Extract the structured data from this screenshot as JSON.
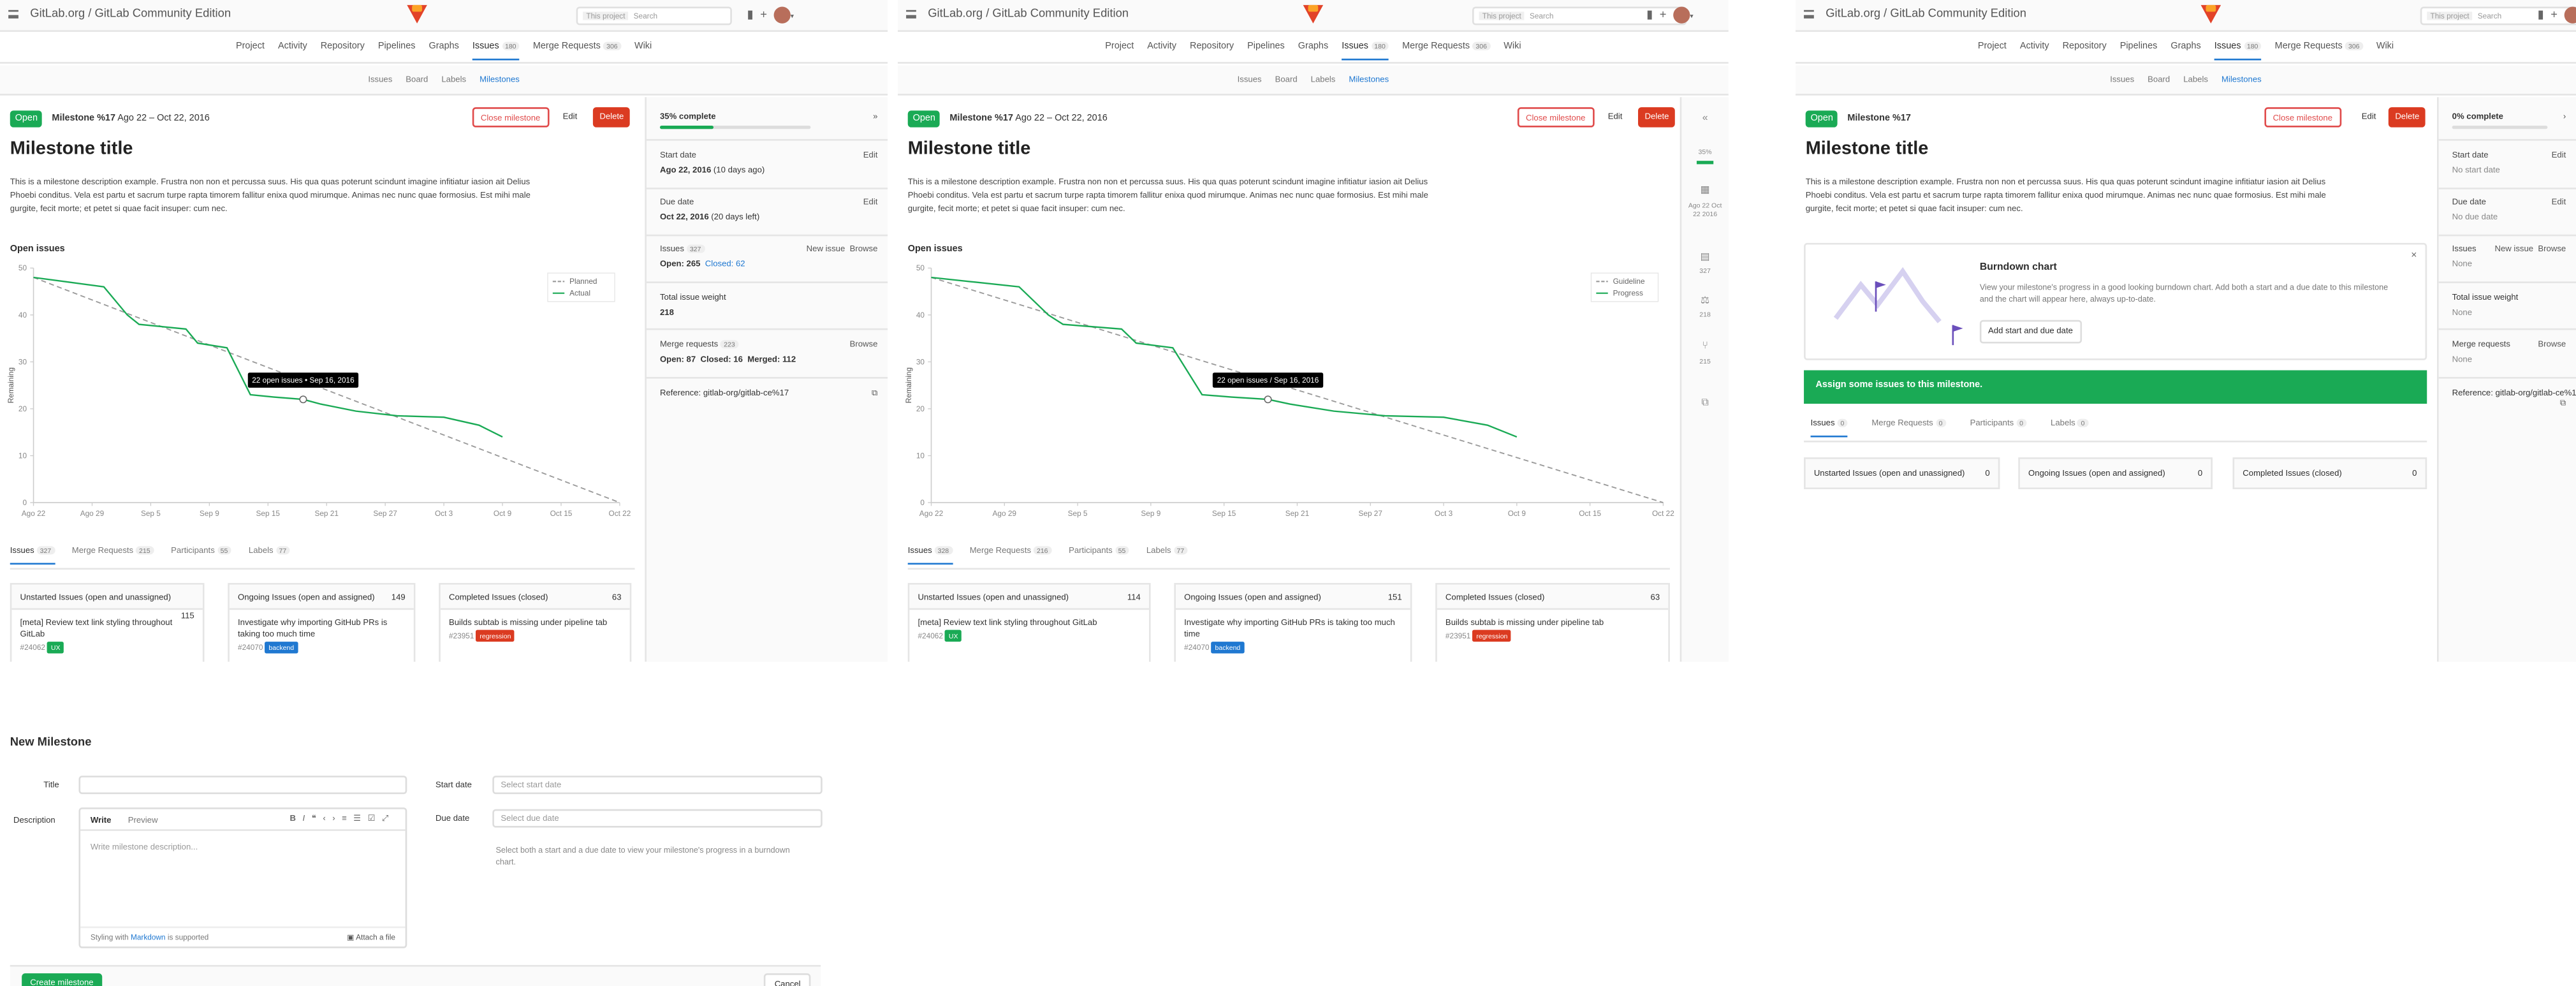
{
  "header": {
    "breadcrumb": "GitLab.org / GitLab Community Edition",
    "search_scope": "This project",
    "search_placeholder": "Search"
  },
  "nav": {
    "project": "Project",
    "activity": "Activity",
    "repository": "Repository",
    "pipelines": "Pipelines",
    "graphs": "Graphs",
    "issues": "Issues",
    "issues_count": "180",
    "merge_requests": "Merge Requests",
    "mr_count": "306",
    "wiki": "Wiki"
  },
  "subnav": {
    "issues": "Issues",
    "board": "Board",
    "labels": "Labels",
    "milestones": "Milestones"
  },
  "milestone": {
    "status": "Open",
    "name": "Milestone %17",
    "dates": "Ago 22 – Oct 22, 2016",
    "close_label": "Close milestone",
    "edit_label": "Edit",
    "delete_label": "Delete",
    "title": "Milestone title",
    "description": "This is a milestone description example. Frustra non non et percussa suus. His qua quas poterunt scindunt imagine infitiatur iasion ait Delius Phoebi conditus. Vela est partu et sacrum turpe rapta timorem fallitur enixa quod mirumque. Animas nec nunc quae formosius. Est mihi male gurgite, fecit morte; et petet si quae facit insuper: cum nec."
  },
  "chart_data": [
    {
      "type": "line",
      "title": "Open issues",
      "ylabel": "Remaining",
      "xlabel": "",
      "x_ticks": [
        "Ago 22",
        "Ago 29",
        "Sep 5",
        "Sep 9",
        "Sep 15",
        "Sep 21",
        "Sep 27",
        "Oct 3",
        "Oct 9",
        "Oct 15",
        "Oct 22"
      ],
      "y_ticks": [
        0,
        10,
        20,
        30,
        40,
        50
      ],
      "ylim": [
        0,
        50
      ],
      "legend_position": "top-right",
      "series": [
        {
          "name": "Planned",
          "style": "dashed",
          "color": "#999999",
          "points": [
            [
              0,
              48
            ],
            [
              10,
              0
            ]
          ]
        },
        {
          "name": "Actual",
          "style": "solid",
          "color": "#1aaa55",
          "points": [
            [
              0,
              48
            ],
            [
              0.6,
              47
            ],
            [
              1.2,
              46
            ],
            [
              1.6,
              40
            ],
            [
              1.8,
              38
            ],
            [
              2.6,
              37
            ],
            [
              2.8,
              34
            ],
            [
              3.3,
              33
            ],
            [
              3.5,
              28
            ],
            [
              3.7,
              23
            ],
            [
              4.1,
              22.5
            ],
            [
              4.6,
              22
            ],
            [
              4.9,
              21
            ],
            [
              5.5,
              19.5
            ],
            [
              6.2,
              18.5
            ],
            [
              7.0,
              18.2
            ],
            [
              7.6,
              16.5
            ],
            [
              8.0,
              14
            ]
          ]
        }
      ],
      "tooltip": "22 open issues • Sep 16, 2016"
    },
    {
      "type": "line",
      "title": "Open issues",
      "ylabel": "Remaining",
      "xlabel": "",
      "x_ticks": [
        "Ago 22",
        "Ago 29",
        "Sep 5",
        "Sep 9",
        "Sep 15",
        "Sep 21",
        "Sep 27",
        "Oct 3",
        "Oct 9",
        "Oct 15",
        "Oct 22"
      ],
      "y_ticks": [
        0,
        10,
        20,
        30,
        40,
        50
      ],
      "ylim": [
        0,
        50
      ],
      "legend_position": "top-right",
      "series": [
        {
          "name": "Guideline",
          "style": "dashed",
          "color": "#999999",
          "points": [
            [
              0,
              48
            ],
            [
              10,
              0
            ]
          ]
        },
        {
          "name": "Progress",
          "style": "solid",
          "color": "#1aaa55",
          "points": [
            [
              0,
              48
            ],
            [
              0.6,
              47
            ],
            [
              1.2,
              46
            ],
            [
              1.6,
              40
            ],
            [
              1.8,
              38
            ],
            [
              2.6,
              37
            ],
            [
              2.8,
              34
            ],
            [
              3.3,
              33
            ],
            [
              3.5,
              28
            ],
            [
              3.7,
              23
            ],
            [
              4.1,
              22.5
            ],
            [
              4.6,
              22
            ],
            [
              4.9,
              21
            ],
            [
              5.5,
              19.5
            ],
            [
              6.2,
              18.5
            ],
            [
              7.0,
              18.2
            ],
            [
              7.6,
              16.5
            ],
            [
              8.0,
              14
            ]
          ]
        }
      ],
      "tooltip": "22 open issues / Sep 16, 2016"
    }
  ],
  "tabs": {
    "issues": "Issues",
    "issues_count_1": "327",
    "issues_count_2": "328",
    "merge_requests": "Merge Requests",
    "mr_count_1": "215",
    "mr_count_2": "216",
    "participants": "Participants",
    "participants_count": "55",
    "labels": "Labels",
    "labels_count": "77"
  },
  "boards": {
    "unstarted": "Unstarted Issues (open and unassigned)",
    "unstarted_count_1": "115",
    "unstarted_count_2": "114",
    "ongoing": "Ongoing Issues (open and assigned)",
    "ongoing_count_1": "149",
    "ongoing_count_2": "151",
    "completed": "Completed Issues (closed)",
    "completed_count": "63",
    "issue1": "[meta] Review text link styling throughout GitLab",
    "issue1_ref": "#24062",
    "issue1_label": "UX",
    "issue2": "Investigate why importing GitHub PRs is taking too much time",
    "issue2_ref": "#24070",
    "issue2_label": "backend",
    "issue3": "Builds subtab is missing under pipeline tab",
    "issue3_ref": "#23951",
    "issue3_label": "regression"
  },
  "sidebar": {
    "complete": "35% complete",
    "complete_pct": 35,
    "start_date": "Start date",
    "start_value": "Ago 22, 2016",
    "start_ago": "(10 days ago)",
    "due_date": "Due date",
    "due_value": "Oct 22, 2016",
    "due_left": "(20 days left)",
    "edit": "Edit",
    "issues": "Issues",
    "issues_count": "327",
    "new_issue": "New issue",
    "browse": "Browse",
    "open": "Open: 265",
    "closed": "Closed: 62",
    "weight": "Total issue weight",
    "weight_value": "218",
    "mr": "Merge requests",
    "mr_count": "223",
    "mr_open": "Open: 87",
    "mr_closed": "Closed: 16",
    "mr_merged": "Merged: 112",
    "reference": "Reference: gitlab-org/gitlab-ce%17"
  },
  "mini_sidebar": {
    "pct": "35%",
    "dates": "Ago 22 Oct 22 2016",
    "issues": "327",
    "weight": "218",
    "mrs": "215"
  },
  "empty_milestone": {
    "complete": "0% complete",
    "complete_pct": 0,
    "no_start": "No start date",
    "no_due": "No due date",
    "none": "None",
    "burndown_title": "Burndown chart",
    "burndown_text": "View your milestone's progress in a good looking burndown chart. Add both a start and a due date to this milestone and the chart will appear here, always up-to-date.",
    "burndown_button": "Add start and due date",
    "assign_alert": "Assign some issues to this milestone.",
    "zero": "0"
  },
  "new_milestone": {
    "heading": "New Milestone",
    "title_label": "Title",
    "desc_label": "Description",
    "write": "Write",
    "preview": "Preview",
    "desc_placeholder": "Write milestone description...",
    "styling": "Styling with",
    "markdown": "Markdown",
    "supported": "is supported",
    "attach": "Attach a file",
    "start_label": "Start date",
    "start_placeholder": "Select start date",
    "due_label": "Due date",
    "due_placeholder": "Select due date",
    "help": "Select both a start and a due date to view your milestone's progress in a burndown chart.",
    "create": "Create milestone",
    "cancel": "Cancel"
  }
}
